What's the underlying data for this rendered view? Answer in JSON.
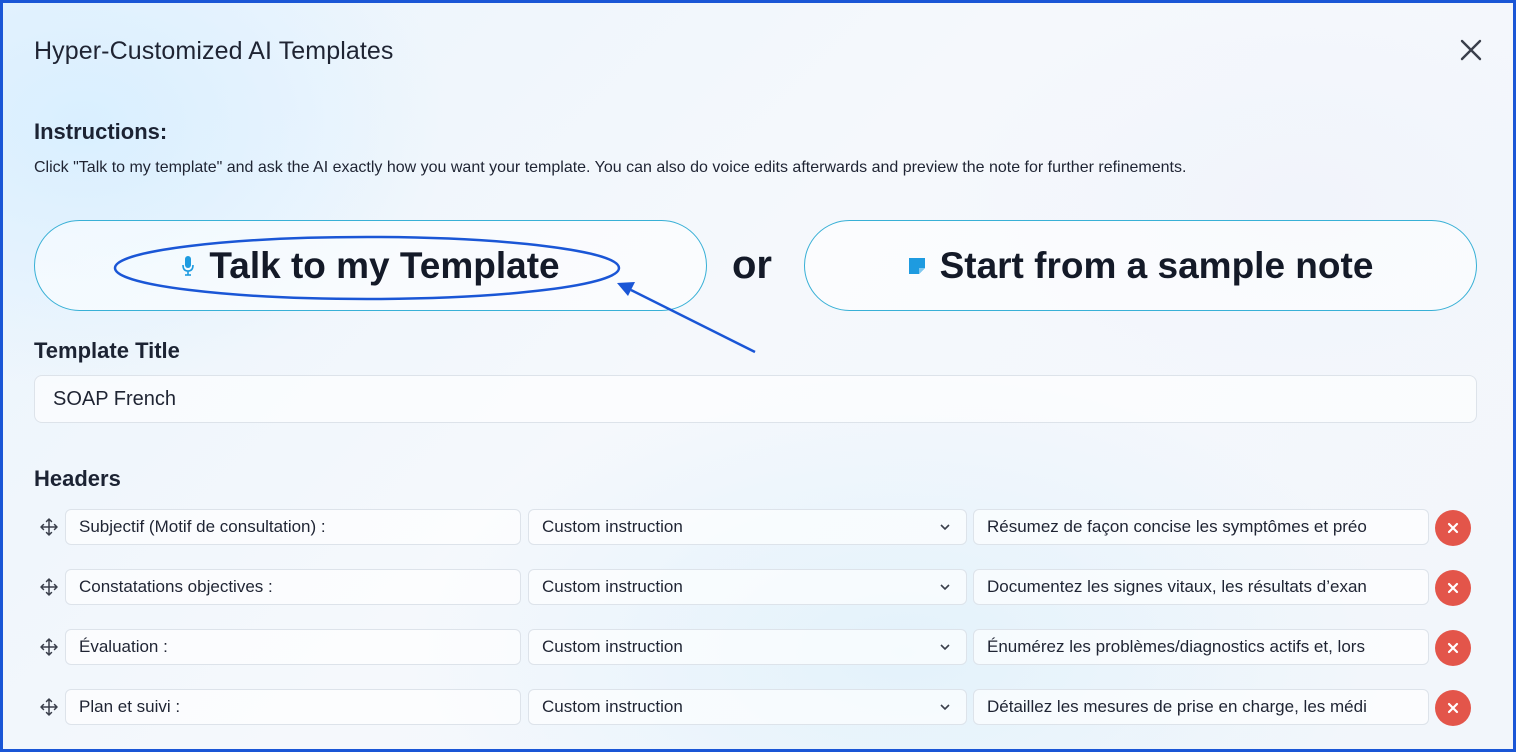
{
  "dialog": {
    "title": "Hyper-Customized AI Templates",
    "close_icon": "close-icon"
  },
  "instructions": {
    "heading": "Instructions:",
    "text": "Click \"Talk to my template\" and ask the AI exactly how you want your template. You can also do voice edits afterwards and preview the note for further refinements."
  },
  "actions": {
    "talk_label": "Talk to my Template",
    "talk_icon": "microphone-icon",
    "or_label": "or",
    "sample_label": "Start from a sample note",
    "sample_icon": "note-icon"
  },
  "template_title": {
    "label": "Template Title",
    "value": "SOAP French"
  },
  "headers": {
    "label": "Headers",
    "rows": [
      {
        "name": "Subjectif (Motif de consultation) :",
        "type": "Custom instruction",
        "instruction": "Résumez de façon concise les symptômes et préo"
      },
      {
        "name": "Constatations objectives :",
        "type": "Custom instruction",
        "instruction": "Documentez les signes vitaux, les résultats d’exan"
      },
      {
        "name": "Évaluation :",
        "type": "Custom instruction",
        "instruction": "Énumérez les problèmes/diagnostics actifs et, lors"
      },
      {
        "name": "Plan et suivi :",
        "type": "Custom instruction",
        "instruction": "Détaillez les mesures de prise en charge, les médi"
      }
    ]
  },
  "colors": {
    "accent_border": "#38b0d6",
    "annotation": "#1a56d6",
    "delete": "#e3554a"
  }
}
